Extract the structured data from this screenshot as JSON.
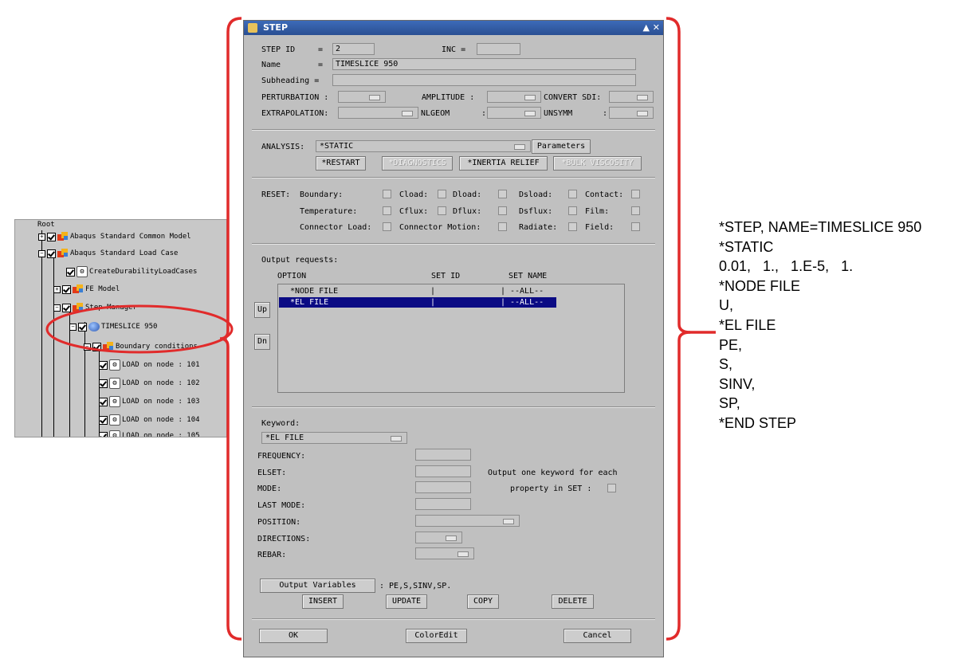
{
  "tree": {
    "root": "Root",
    "items": [
      {
        "label": "Abaqus Standard Common Model"
      },
      {
        "label": "Abaqus Standard Load Case"
      },
      {
        "label": "CreateDurabilityLoadCases"
      },
      {
        "label": "FE Model"
      },
      {
        "label": "Step Manager"
      },
      {
        "label": "TIMESLICE 950"
      },
      {
        "label": "Boundary conditions"
      },
      {
        "label": "LOAD on node : 101"
      },
      {
        "label": "LOAD on node : 102"
      },
      {
        "label": "LOAD on node : 103"
      },
      {
        "label": "LOAD on node : 104"
      },
      {
        "label": "LOAD on node : 105"
      }
    ]
  },
  "dialog": {
    "title": "STEP",
    "title_buttons": "▲ ✕",
    "step_id_label": "STEP ID",
    "eq": "=",
    "step_id_value": "2",
    "inc_label": "INC =",
    "inc_value": "",
    "name_label": "Name",
    "name_value": "TIMESLICE 950",
    "subheading_label": "Subheading =",
    "subheading_value": "",
    "perturbation_label": "PERTURBATION :",
    "amplitude_label": "AMPLITUDE :",
    "convert_sdi_label": "CONVERT SDI:",
    "extrapolation_label": "EXTRAPOLATION:",
    "nlgeom_label": "NLGEOM",
    "nlgeom_colon": ":",
    "unsymm_label": "UNSYMM",
    "unsymm_colon": ":",
    "analysis_label": "ANALYSIS:",
    "analysis_value": "*STATIC",
    "parameters_btn": "Parameters",
    "restart_btn": "*RESTART",
    "diagnostics_btn": "*DIAGNOSTICS",
    "inertia_btn": "*INERTIA RELIEF",
    "bulk_btn": "*BULK VISCOSITY",
    "reset_label": "RESET:",
    "reset": {
      "boundary": "Boundary:",
      "cload": "Cload:",
      "dload": "Dload:",
      "dsload": "Dsload:",
      "contact": "Contact:",
      "temperature": "Temperature:",
      "cflux": "Cflux:",
      "dflux": "Dflux:",
      "dsflux": "Dsflux:",
      "film": "Film:",
      "connector_load": "Connector Load:",
      "connector_motion": "Connector Motion:",
      "radiate": "Radiate:",
      "field": "Field:"
    },
    "output_requests_label": "Output requests:",
    "col_option": "OPTION",
    "col_setid": "SET ID",
    "col_setname": "SET NAME",
    "rows": [
      {
        "option": "*NODE FILE",
        "setid": "|",
        "sep": "|",
        "setname": "--ALL--"
      },
      {
        "option": "*EL FILE",
        "setid": "|",
        "sep": "|",
        "setname": "--ALL--"
      }
    ],
    "up_btn": "Up",
    "dn_btn": "Dn",
    "keyword_label": "Keyword:",
    "keyword_value": "*EL FILE",
    "frequency_label": "FREQUENCY:",
    "elset_label": "ELSET:",
    "mode_label": "MODE:",
    "last_mode_label": "LAST MODE:",
    "position_label": "POSITION:",
    "directions_label": "DIRECTIONS:",
    "rebar_label": "REBAR:",
    "output_one_line1": "Output one keyword for each",
    "output_one_line2": "property in SET :",
    "output_vars_btn": "Output Variables",
    "output_vars_value": ": PE,S,SINV,SP.",
    "insert_btn": "INSERT",
    "update_btn": "UPDATE",
    "copy_btn": "COPY",
    "delete_btn": "DELETE",
    "ok_btn": "OK",
    "coloredit_btn": "ColorEdit",
    "cancel_btn": "Cancel"
  },
  "annotation_lines": [
    "*STEP, NAME=TIMESLICE 950",
    "*STATIC",
    "0.01,   1.,   1.E-5,   1.",
    "*NODE FILE",
    "U,",
    "*EL FILE",
    "PE,",
    "S,",
    "SINV,",
    "SP,",
    "*END STEP"
  ],
  "colors": {
    "bracket": "#e12b2b",
    "selection": "#0b0b84",
    "titlebar": "#3d6bb8"
  }
}
